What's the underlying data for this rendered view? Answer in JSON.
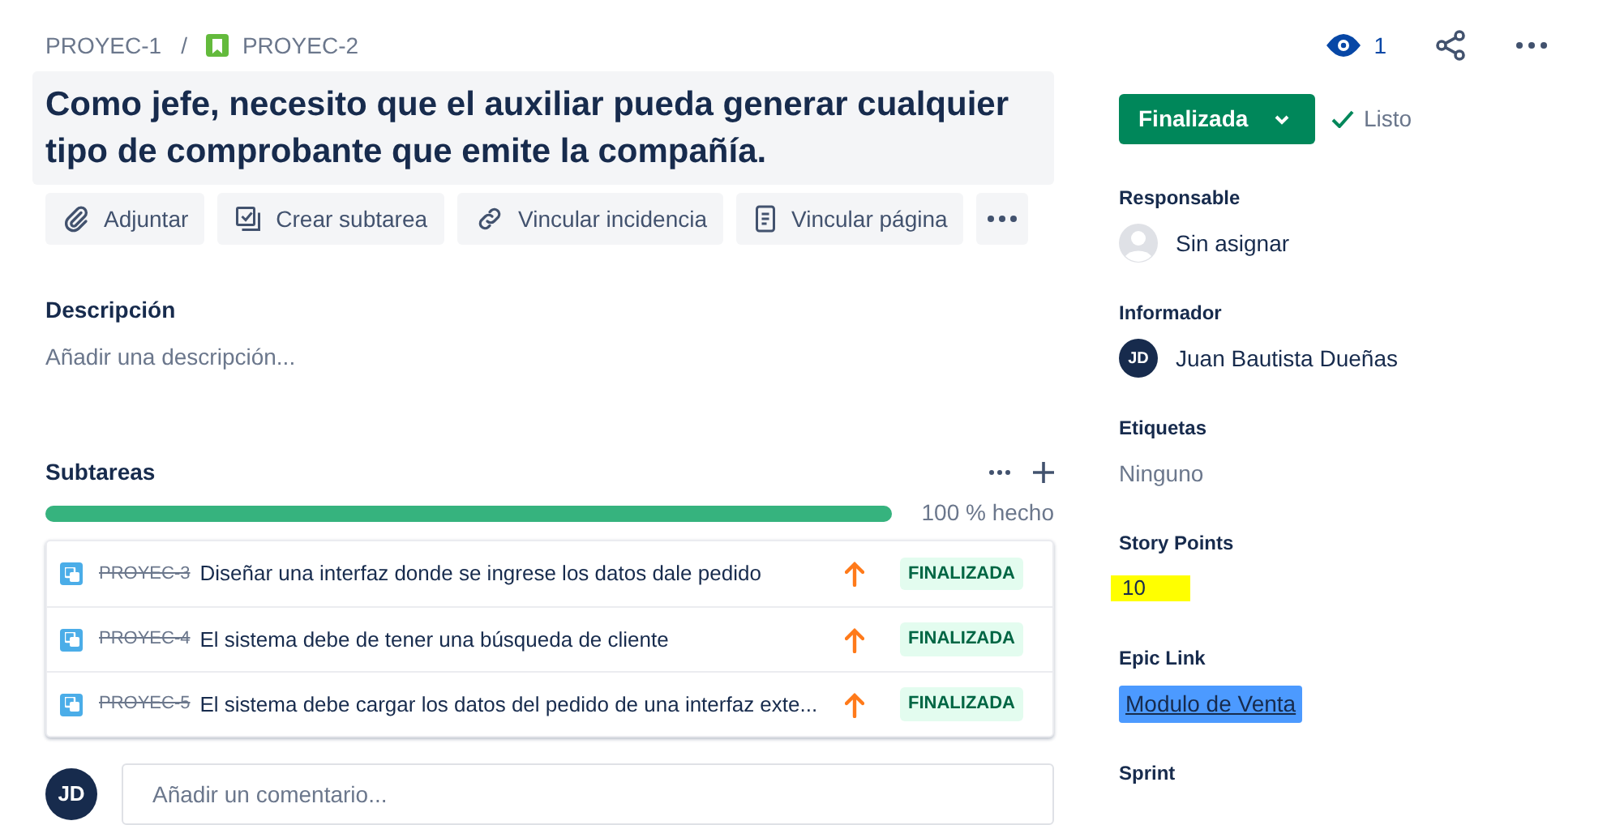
{
  "breadcrumb_separator": "/",
  "breadcrumbs": [
    {
      "label": "PROYEC-1",
      "kind": "plain"
    },
    {
      "label": "PROYEC-2",
      "kind": "story"
    }
  ],
  "title": "Como jefe, necesito que el auxiliar pueda generar cualquier tipo de comprobante que emite la compañía.",
  "actions": [
    {
      "label": "Adjuntar",
      "kind": "attach"
    },
    {
      "label": "Crear subtarea",
      "kind": "subtask"
    },
    {
      "label": "Vincular incidencia",
      "kind": "link"
    },
    {
      "label": "Vincular página",
      "kind": "page"
    }
  ],
  "description": {
    "label": "Descripción",
    "placeholder": "Añadir una descripción..."
  },
  "subtasks": {
    "label": "Subtareas",
    "level": 1,
    "progress_text": "100 % hecho",
    "items": [
      {
        "key": "PROYEC-3",
        "done": true,
        "summary": "Diseñar una interfaz donde se ingrese los datos dale pedido",
        "status": "FINALIZADA"
      },
      {
        "key": "PROYEC-4",
        "done": true,
        "summary": "El sistema debe de tener una búsqueda de cliente",
        "status": "FINALIZADA"
      },
      {
        "key": "PROYEC-5",
        "done": true,
        "summary": "El sistema debe cargar los datos del pedido de una interfaz exte...",
        "status": "FINALIZADA"
      }
    ]
  },
  "comment": {
    "avatar": "JD",
    "placeholder": "Añadir un comentario..."
  },
  "watchers": "1",
  "status": {
    "label": "Finalizada",
    "resolution": "Listo"
  },
  "fields": [
    {
      "label": "Responsable",
      "kind": "unassigned",
      "value": "Sin asignar"
    },
    {
      "label": "Informador",
      "kind": "user",
      "avatar": "JD",
      "value": "Juan Bautista Dueñas"
    },
    {
      "label": "Etiquetas",
      "kind": "empty",
      "value": "Ninguno"
    },
    {
      "label": "Story Points",
      "kind": "highlight",
      "value": "10"
    },
    {
      "label": "Epic Link",
      "kind": "epic",
      "value": "Modulo de Venta"
    },
    {
      "label": "Sprint",
      "kind": "label_only"
    }
  ]
}
